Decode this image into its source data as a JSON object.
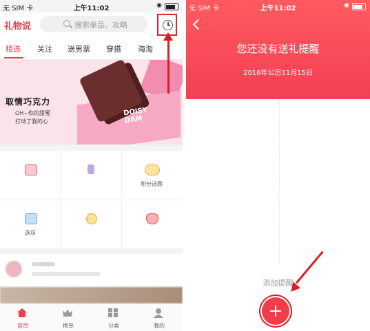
{
  "left": {
    "status": {
      "carrier": "无 SIM 卡 ",
      "time": "上午11:02"
    },
    "header": {
      "brand": "礼物说",
      "search_placeholder": "搜索单品、攻略"
    },
    "tabs": [
      "精选",
      "关注",
      "送男票",
      "穿搭",
      "海淘"
    ],
    "active_tab": "精选",
    "banner": {
      "tagline": "取情巧克力",
      "sub_line1": "OH~你的甜蜜",
      "sub_line2": "打动了我的心",
      "brand_line1": "DOISY",
      "brand_line2": "DAM"
    },
    "grid": [
      {
        "icon": "gift-icon",
        "label": ""
      },
      {
        "icon": "rank-one-icon",
        "label": ""
      },
      {
        "icon": "points-icon",
        "label": "积分话题"
      },
      {
        "icon": "shop-icon",
        "label": "逛店"
      },
      {
        "icon": "badge-icon",
        "label": ""
      },
      {
        "icon": "lucky-bag-icon",
        "label": ""
      }
    ],
    "bottom_nav": [
      {
        "label": "首页",
        "icon": "home-icon",
        "active": true
      },
      {
        "label": "榜单",
        "icon": "crown-icon",
        "active": false
      },
      {
        "label": "分类",
        "icon": "category-icon",
        "active": false
      },
      {
        "label": "我的",
        "icon": "user-icon",
        "active": false
      }
    ]
  },
  "right": {
    "status": {
      "carrier": "无 SIM 卡 ",
      "time": "上午11:02"
    },
    "title": "您还没有送礼提醒",
    "date": "2016年公历11月15日",
    "add_label": "添加提醒"
  },
  "colors": {
    "accent": "#e8414b",
    "annotation": "#e21b22",
    "header_gradient_top": "#ff5a5f",
    "header_gradient_bottom": "#f43f54"
  }
}
